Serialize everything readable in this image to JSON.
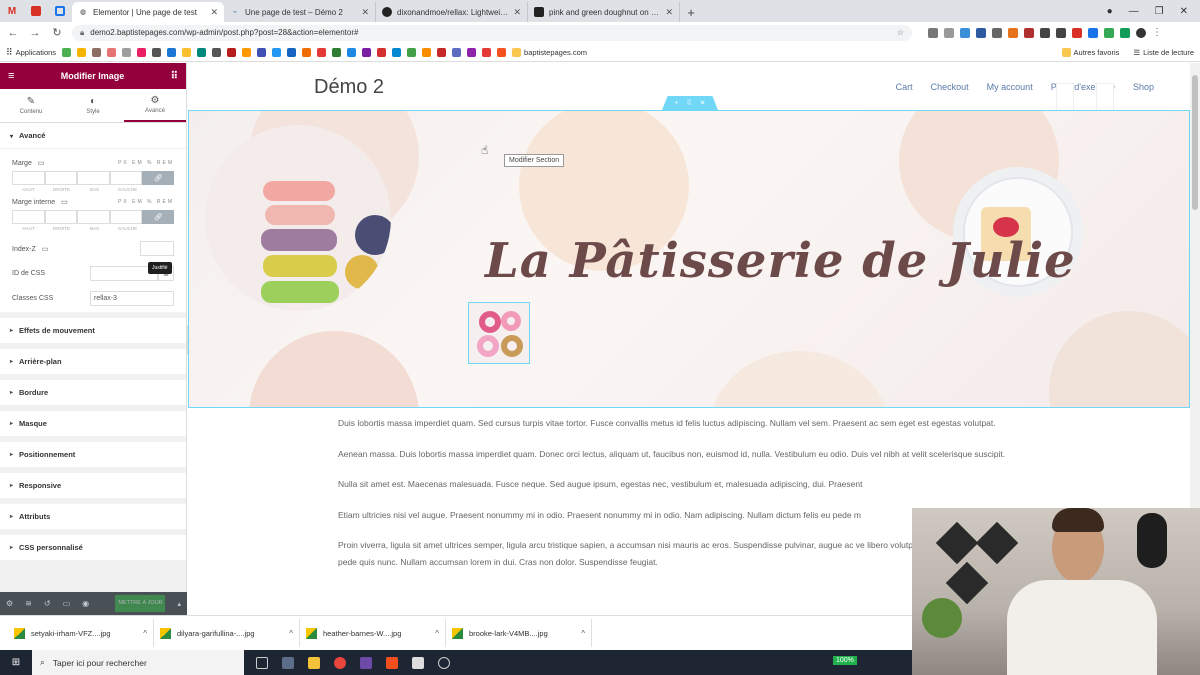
{
  "browser": {
    "tabs": [
      {
        "title": "Elementor | Une page de test",
        "active": true
      },
      {
        "title": "Une page de test – Démo 2",
        "active": false
      },
      {
        "title": "dixonandmoe/rellax: Lightweight",
        "active": false
      },
      {
        "title": "pink and green doughnut on whi",
        "active": false
      }
    ],
    "url": "demo2.baptistepages.com/wp-admin/post.php?post=28&action=elementor#",
    "bookmarks": {
      "apps_label": "Applications",
      "folder_label": "baptistepages.com",
      "other_favorites": "Autres favoris",
      "reading_list": "Liste de lecture"
    }
  },
  "panel": {
    "title": "Modifier Image",
    "tabs": [
      "Contenu",
      "Style",
      "Avancé"
    ],
    "open_section": "Avancé",
    "margin_label": "Marge",
    "padding_label": "Marge interne",
    "units": "PX EM % REM",
    "dim_labels": [
      "HAUT",
      "DROITE",
      "BAS",
      "GAUCHE"
    ],
    "zindex_label": "Index-Z",
    "css_id_label": "ID de CSS",
    "css_classes_label": "Classes CSS",
    "css_classes_value": "rellax-3",
    "tooltip": "Justifié",
    "collapsed_sections": [
      "Effets de mouvement",
      "Arrière-plan",
      "Bordure",
      "Masque",
      "Positionnement",
      "Responsive",
      "Attributs",
      "CSS personnalisé"
    ],
    "update_button": "METTRE À JOUR"
  },
  "site": {
    "title": "Démo 2",
    "nav": [
      "Cart",
      "Checkout",
      "My account",
      "Page d'exemple",
      "Shop"
    ],
    "hero_title": "La Pâtisserie de Julie",
    "edit_tooltip": "Modifier Section",
    "paragraphs": [
      "Duis lobortis massa imperdiet quam. Sed cursus turpis vitae tortor. Fusce convallis metus id felis luctus adipiscing. Nullam vel sem. Praesent ac sem eget est egestas volutpat.",
      "Aenean massa. Duis lobortis massa imperdiet quam. Donec orci lectus, aliquam ut, faucibus non, euismod id, nulla. Vestibulum eu odio. Duis vel nibh at velit scelerisque suscipit.",
      "Nulla sit amet est. Maecenas malesuada. Fusce neque. Sed augue ipsum, egestas nec, vestibulum et, malesuada adipiscing, dui. Praesent",
      "Etiam ultricies nisi vel augue. Praesent nonummy mi in odio. Praesent nonummy mi in odio. Nam adipiscing. Nullam dictum felis eu pede m",
      "Proin viverra, ligula sit amet ultrices semper, ligula arcu tristique sapien, a accumsan nisi mauris ac eros. Suspendisse pulvinar, augue ac ve libero volutpat nibh, nec pellentesque velit pede quis nunc. Nullam accumsan lorem in dui. Cras non dolor. Suspendisse feugiat."
    ]
  },
  "downloads": [
    {
      "name": "setyaki-irham-VFZ....jpg"
    },
    {
      "name": "dilyara-garifullina-....jpg"
    },
    {
      "name": "heather-barnes-W....jpg"
    },
    {
      "name": "brooke-lark-V4MB....jpg"
    }
  ],
  "taskbar": {
    "search_placeholder": "Taper ici pour rechercher",
    "battery": "100%"
  },
  "colors": {
    "elementor_brand": "#93003c",
    "selection_outline": "#71d7f7",
    "nav_link": "#5b7aa8",
    "hero_title": "#6d4a4a"
  }
}
